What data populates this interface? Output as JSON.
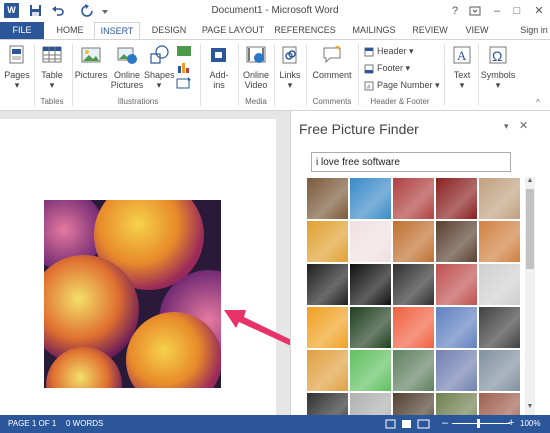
{
  "titlebar": {
    "title": "Document1 - Microsoft Word",
    "word_icon_letter": "W",
    "help": "?",
    "minimize": "–",
    "maximize": "□",
    "close": "✕"
  },
  "tabs": [
    {
      "key": "file",
      "label": "FILE"
    },
    {
      "key": "home",
      "label": "HOME"
    },
    {
      "key": "insert",
      "label": "INSERT",
      "active": true
    },
    {
      "key": "design",
      "label": "DESIGN"
    },
    {
      "key": "page_layout",
      "label": "PAGE LAYOUT"
    },
    {
      "key": "references",
      "label": "REFERENCES"
    },
    {
      "key": "mailings",
      "label": "MAILINGS"
    },
    {
      "key": "review",
      "label": "REVIEW"
    },
    {
      "key": "view",
      "label": "VIEW"
    }
  ],
  "sign_in": "Sign in",
  "ribbon": {
    "pages": "Pages",
    "table": "Table",
    "tables_group": "Tables",
    "pictures": "Pictures",
    "online_pictures_1": "Online",
    "online_pictures_2": "Pictures",
    "shapes": "Shapes",
    "illustrations_group": "Illustrations",
    "addins_1": "Add-",
    "addins_2": "ins",
    "online_video_1": "Online",
    "online_video_2": "Video",
    "media_group": "Media",
    "links": "Links",
    "comment": "Comment",
    "comments_group": "Comments",
    "header": "Header",
    "footer": "Footer",
    "page_number": "Page Number",
    "header_footer_group": "Header & Footer",
    "text": "Text",
    "symbols": "Symbols"
  },
  "pane": {
    "title": "Free Picture Finder",
    "search_value": "i love free software",
    "thumbnails": [
      "#7a5a3a",
      "#3a8ac8",
      "#b04040",
      "#8a2020",
      "#c0a080",
      "#e0a030",
      "#f0e0e0",
      "#c07030",
      "#5a4030",
      "#d08040",
      "#202020",
      "#101010",
      "#303030",
      "#c05050",
      "#d0d0d0",
      "#f0a020",
      "#204020",
      "#f06040",
      "#6080c0",
      "#404040",
      "#e0a040",
      "#60c060",
      "#608060",
      "#7080b0",
      "#8090a0",
      "#303030",
      "#b0b0b0",
      "#504030",
      "#708050",
      "#a06050"
    ]
  },
  "colors": {
    "accent": "#2b579a",
    "arrow": "#e8336a"
  },
  "status": {
    "page": "PAGE 1 OF 1",
    "words": "0 WORDS",
    "zoom_level": "100%",
    "zoom_out": "–",
    "zoom_in": "+"
  }
}
